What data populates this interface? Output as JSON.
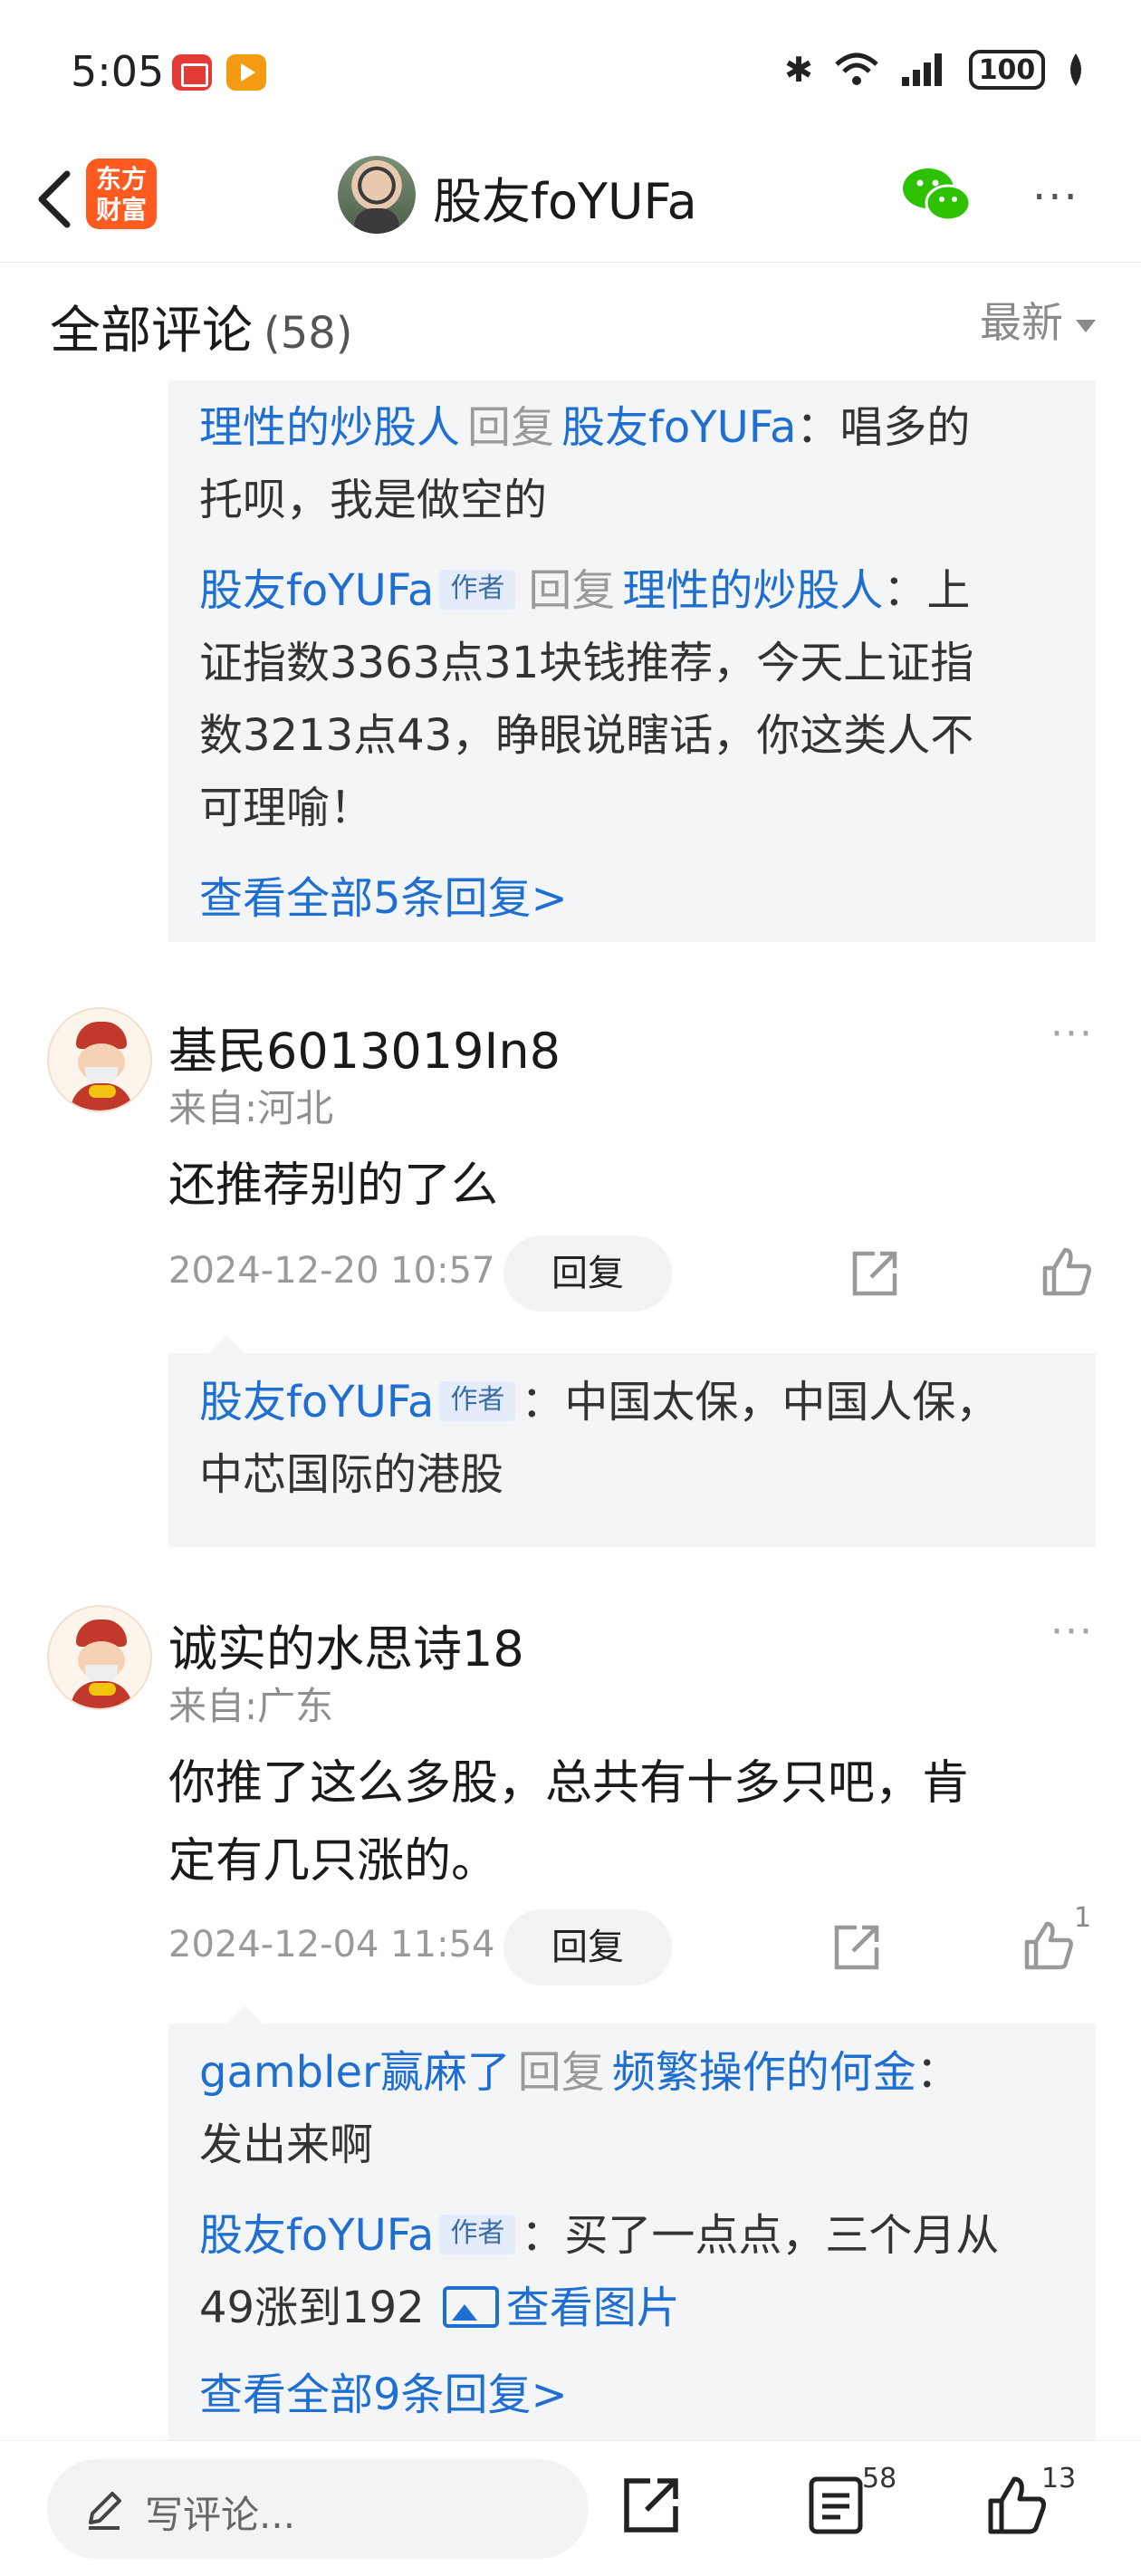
{
  "status_bar": {
    "time": "5:05",
    "battery": "100"
  },
  "nav": {
    "logo_line1": "东方",
    "logo_line2": "财富",
    "title": "股友foYUFa"
  },
  "section": {
    "title": "全部评论",
    "count": "(58)",
    "sort_label": "最新"
  },
  "thread1": {
    "replies": [
      {
        "user": "理性的炒股人",
        "reply_word": "回复",
        "target": "股友foYUFa",
        "line1_rest": "：唱多的",
        "line2": "托呗，我是做空的"
      },
      {
        "user": "股友foYUFa",
        "author_tag": "作者",
        "reply_word": "回复",
        "target": "理性的炒股人",
        "line1_rest": "：上",
        "line2": "证指数3363点31块钱推荐，今天上证指",
        "line3": "数3213点43，睁眼说瞎话，你这类人不",
        "line4": "可理喻！"
      }
    ],
    "view_all": "查看全部5条回复>"
  },
  "comments": [
    {
      "name": "基民6013019In8",
      "location": "来自:河北",
      "text_line1": "还推荐别的了么",
      "time": "2024-12-20 10:57",
      "reply_label": "回复",
      "likes": "",
      "reply": {
        "user": "股友foYUFa",
        "author_tag": "作者",
        "line1_rest": "：中国太保，中国人保，",
        "line2": "中芯国际的港股"
      }
    },
    {
      "name": "诚实的水思诗18",
      "location": "来自:广东",
      "text_line1": "你推了这么多股，总共有十多只吧，肯",
      "text_line2": "定有几只涨的。",
      "time": "2024-12-04 11:54",
      "reply_label": "回复",
      "likes": "1",
      "replies": [
        {
          "user": "gambler赢麻了",
          "reply_word": "回复",
          "target": "频繁操作的何金",
          "line1_rest": "：",
          "line2": "发出来啊"
        },
        {
          "user": "股友foYUFa",
          "author_tag": "作者",
          "line1_rest": "：买了一点点，三个月从",
          "line2": "49涨到192",
          "image_link": "查看图片"
        }
      ],
      "view_all": "查看全部9条回复>"
    }
  ],
  "bottom_bar": {
    "placeholder": "写评论...",
    "comment_count": "58",
    "like_count": "13"
  }
}
